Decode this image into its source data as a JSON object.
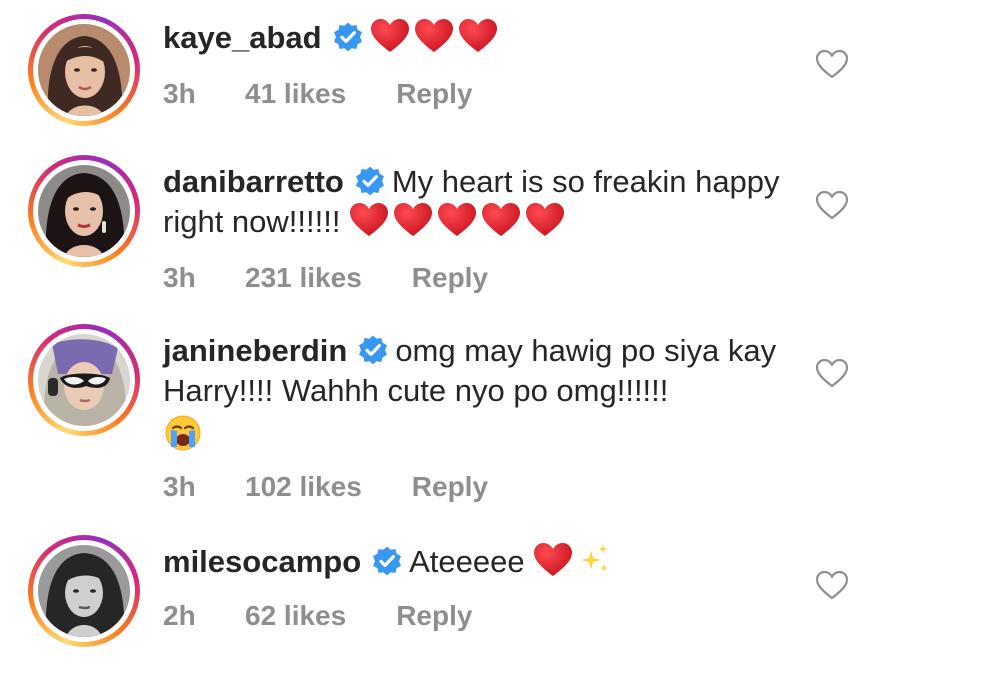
{
  "comments": [
    {
      "username": "kaye_abad",
      "text": "",
      "emoji": "heart x3",
      "time": "3h",
      "likes": "41 likes",
      "reply": "Reply"
    },
    {
      "username": "danibarretto",
      "text": "My heart is so freakin happy right now!!!!!!",
      "emoji": "heart x5",
      "time": "3h",
      "likes": "231 likes",
      "reply": "Reply"
    },
    {
      "username": "janineberdin",
      "text": "omg may hawig po siya kay Harry!!!! Wahhh cute nyo po omg!!!!!!",
      "emoji": "loudly-crying-face",
      "time": "3h",
      "likes": "102 likes",
      "reply": "Reply"
    },
    {
      "username": "milesocampo",
      "text": "Ateeeee",
      "emoji": "heart, sparkles",
      "time": "2h",
      "likes": "62 likes",
      "reply": "Reply"
    }
  ],
  "colors": {
    "text": "#262626",
    "meta": "#8e8e8e",
    "verified": "#3897f0",
    "heart": "#e0202e"
  },
  "icons": {
    "verified": "verified-badge-icon",
    "like": "heart-outline-icon",
    "emoji_heart": "red-heart-icon"
  }
}
